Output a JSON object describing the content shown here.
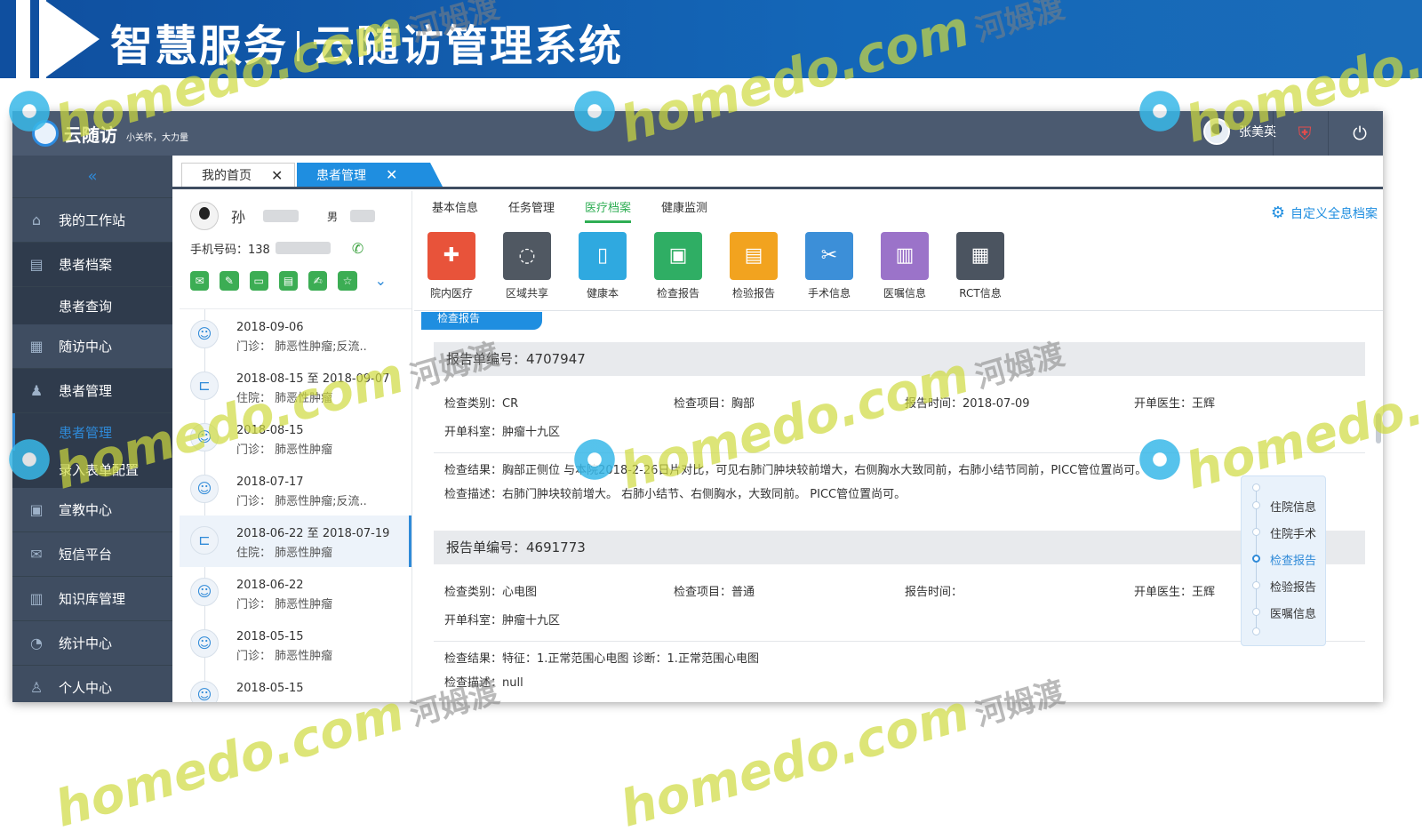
{
  "banner": {
    "title_left": "智慧服务",
    "title_right": "云随访管理系统"
  },
  "app": {
    "logo_name": "云随访",
    "slogan": "小关怀，大力量",
    "user_name": "张美英"
  },
  "sidebar": {
    "collapse_icon": "«",
    "items": [
      {
        "label": "我的工作站",
        "icon": "home-icon"
      },
      {
        "label": "患者档案",
        "icon": "archive-icon"
      },
      {
        "label": "患者查询"
      },
      {
        "label": "随访中心",
        "icon": "followup-icon"
      },
      {
        "label": "患者管理",
        "icon": "patient-icon"
      },
      {
        "label": "患者管理"
      },
      {
        "label": "录入表单配置"
      },
      {
        "label": "宣教中心",
        "icon": "education-icon"
      },
      {
        "label": "短信平台",
        "icon": "sms-icon"
      },
      {
        "label": "知识库管理",
        "icon": "knowledge-icon"
      },
      {
        "label": "统计中心",
        "icon": "stats-icon"
      },
      {
        "label": "个人中心",
        "icon": "person-icon"
      }
    ]
  },
  "tabs": [
    {
      "label": "我的首页"
    },
    {
      "label": "患者管理"
    }
  ],
  "patient": {
    "name": "孙",
    "sex": "男",
    "phone_label": "手机号码：138"
  },
  "timeline": [
    {
      "date": "2018-09-06",
      "detail": "门诊： 肺恶性肿瘤;反流..",
      "type": "outpatient"
    },
    {
      "date": "2018-08-15 至 2018-09-07",
      "detail": "住院： 肺恶性肿瘤",
      "type": "inpatient"
    },
    {
      "date": "2018-08-15",
      "detail": "门诊： 肺恶性肿瘤",
      "type": "outpatient"
    },
    {
      "date": "2018-07-17",
      "detail": "门诊： 肺恶性肿瘤;反流..",
      "type": "outpatient"
    },
    {
      "date": "2018-06-22 至 2018-07-19",
      "detail": "住院： 肺恶性肿瘤",
      "type": "inpatient"
    },
    {
      "date": "2018-06-22",
      "detail": "门诊： 肺恶性肿瘤",
      "type": "outpatient"
    },
    {
      "date": "2018-05-15",
      "detail": "门诊： 肺恶性肿瘤",
      "type": "outpatient"
    },
    {
      "date": "2018-05-15",
      "detail": "",
      "type": "outpatient"
    }
  ],
  "main": {
    "subtabs": [
      "基本信息",
      "任务管理",
      "医疗档案",
      "健康监测"
    ],
    "active_subtab": "医疗档案",
    "custom_label": "自定义全息档案",
    "tiles": [
      {
        "label": "院内医疗",
        "color": "#e8533a",
        "icon": "medkit-icon"
      },
      {
        "label": "区域共享",
        "color": "#505862",
        "icon": "share-icon"
      },
      {
        "label": "健康本",
        "color": "#2fa9e0",
        "icon": "health-book-icon"
      },
      {
        "label": "检查报告",
        "color": "#2fae64",
        "icon": "exam-report-icon"
      },
      {
        "label": "检验报告",
        "color": "#f2a31f",
        "icon": "lab-report-icon"
      },
      {
        "label": "手术信息",
        "color": "#3c8fd8",
        "icon": "surgery-icon"
      },
      {
        "label": "医嘱信息",
        "color": "#9b73c9",
        "icon": "order-icon"
      },
      {
        "label": "RCT信息",
        "color": "#4b5460",
        "icon": "rct-icon"
      }
    ],
    "section_tag": "检查报告",
    "reports": [
      {
        "title": "报告单编号：4707947",
        "type": "检查类别：CR",
        "item": "检查项目：胸部",
        "time": "报告时间：2018-07-09",
        "doctor": "开单医生：王辉",
        "dept": "开单科室：肿瘤十九区",
        "result": "检查结果：胸部正侧位 与本院2018-2-26日片对比，可见右肺门肿块较前增大，右侧胸水大致同前，右肺小结节同前，PICC管位置尚可。",
        "desc": "检查描述：右肺门肿块较前增大。 右肺小结节、右侧胸水，大致同前。 PICC管位置尚可。"
      },
      {
        "title": "报告单编号：4691773",
        "type": "检查类别：心电图",
        "item": "检查项目：普通",
        "time": "报告时间：",
        "doctor": "开单医生：王辉",
        "dept": "开单科室：肿瘤十九区",
        "result": "检查结果：特征：1.正常范围心电图 诊断：1.正常范围心电图",
        "desc": "检查描述：null"
      }
    ],
    "rail": [
      "住院信息",
      "住院手术",
      "检查报告",
      "检验报告",
      "医嘱信息"
    ],
    "rail_active": "检查报告"
  },
  "watermark": {
    "en": "homedo.com",
    "cn": "河姆渡"
  }
}
